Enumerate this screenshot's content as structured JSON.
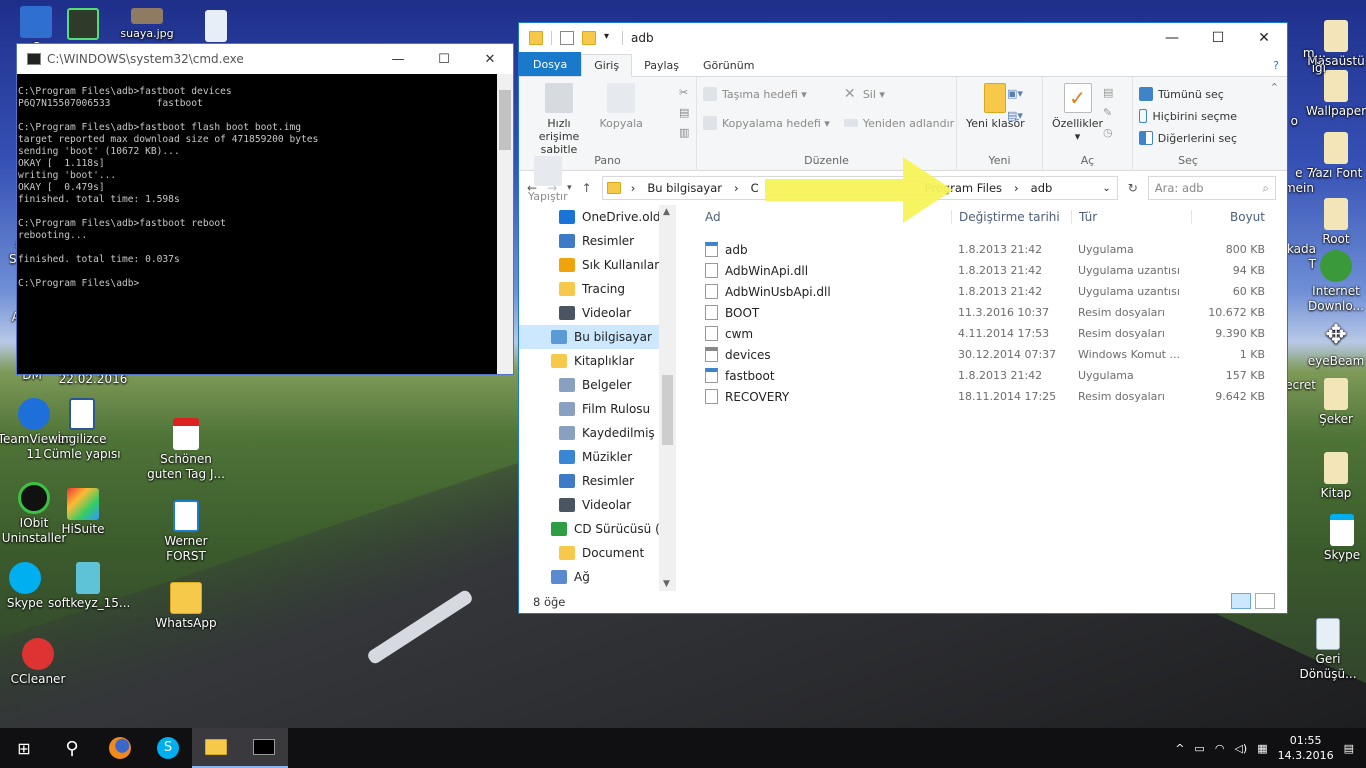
{
  "desktop": {
    "icons_left": [
      {
        "label": "",
        "glyph": "🖥"
      },
      {
        "label": "",
        "glyph": "🎞"
      },
      {
        "label": "suaya.jpg",
        "glyph": "🖼"
      },
      {
        "label": "",
        "glyph": "📄"
      },
      {
        "label": "TeamViewer 11",
        "glyph": "↔"
      },
      {
        "label": "İngilizce Cümle yapısı",
        "glyph": "W"
      },
      {
        "label": "Schönen guten Tag J...",
        "glyph": "PDF"
      },
      {
        "label": "IObit Uninstaller",
        "glyph": "U"
      },
      {
        "label": "HiSuite",
        "glyph": "◆"
      },
      {
        "label": "Werner FORST",
        "glyph": "◎"
      },
      {
        "label": "Skype",
        "glyph": "S"
      },
      {
        "label": "softkeyz_15...",
        "glyph": "▮"
      },
      {
        "label": "WhatsApp",
        "glyph": "📁"
      },
      {
        "label": "CCleaner",
        "glyph": "C"
      }
    ],
    "partial_labels": [
      "C",
      "Ac",
      "Sys",
      "A",
      "DM",
      "22.02.2016"
    ],
    "icons_right": [
      {
        "label": "Masaüstü"
      },
      {
        "label": "Wallpaper"
      },
      {
        "label": "Yazı Font"
      },
      {
        "label": "Root"
      },
      {
        "label": "Internet Downlo..."
      },
      {
        "label": "eyeBeam"
      },
      {
        "label": "Şeker"
      },
      {
        "label": "Kitap"
      },
      {
        "label": "Skype"
      },
      {
        "label": "Geri Dönüşü..."
      }
    ],
    "partial_right": [
      "m...",
      "ığı",
      "o",
      "e 7",
      "mein",
      "kada",
      "T",
      "ecret"
    ]
  },
  "cmd": {
    "title": "C:\\WINDOWS\\system32\\cmd.exe",
    "output": "C:\\Program Files\\adb>fastboot devices\nP6Q7N15507006533        fastboot\n\nC:\\Program Files\\adb>fastboot flash boot boot.img\ntarget reported max download size of 471859200 bytes\nsending 'boot' (10672 KB)...\nOKAY [  1.118s]\nwriting 'boot'...\nOKAY [  0.479s]\nfinished. total time: 1.598s\n\nC:\\Program Files\\adb>fastboot reboot\nrebooting...\n\nfinished. total time: 0.037s\n\nC:\\Program Files\\adb>"
  },
  "explorer": {
    "title": "adb",
    "tabs": {
      "file": "Dosya",
      "home": "Giriş",
      "share": "Paylaş",
      "view": "Görünüm"
    },
    "ribbon": {
      "pin": "Hızlı erişime sabitle",
      "copy": "Kopyala",
      "paste": "Yapıştır",
      "clipboard": "Pano",
      "moveto": "Taşıma hedefi",
      "copyto": "Kopyalama hedefi",
      "delete": "Sil",
      "rename": "Yeniden adlandır",
      "organize": "Düzenle",
      "newfolder": "Yeni klasör",
      "new": "Yeni",
      "properties": "Özellikler",
      "open": "Aç",
      "selectall": "Tümünü seç",
      "selectnone": "Hiçbirini seçme",
      "invert": "Diğerlerini seç",
      "select": "Seç"
    },
    "address": {
      "seg1": "Bu bilgisayar",
      "seg2": "C",
      "seg3": "Program Files",
      "seg4": "adb",
      "search": "Ara: adb"
    },
    "nav": [
      {
        "label": "OneDrive.old",
        "indent": 1
      },
      {
        "label": "Resimler",
        "indent": 1
      },
      {
        "label": "Sık Kullanılanlar",
        "indent": 1
      },
      {
        "label": "Tracing",
        "indent": 1
      },
      {
        "label": "Videolar",
        "indent": 1
      },
      {
        "label": "Bu bilgisayar",
        "indent": 0,
        "selected": true
      },
      {
        "label": "Kitaplıklar",
        "indent": 0
      },
      {
        "label": "Belgeler",
        "indent": 1
      },
      {
        "label": "Film Rulosu",
        "indent": 1
      },
      {
        "label": "Kaydedilmiş Re",
        "indent": 1
      },
      {
        "label": "Müzikler",
        "indent": 1
      },
      {
        "label": "Resimler",
        "indent": 1
      },
      {
        "label": "Videolar",
        "indent": 1
      },
      {
        "label": "CD Sürücüsü (F:)",
        "indent": 0
      },
      {
        "label": "Document",
        "indent": 1
      },
      {
        "label": "Ağ",
        "indent": 0
      }
    ],
    "columns": {
      "name": "Ad",
      "date": "Değiştirme tarihi",
      "type": "Tür",
      "size": "Boyut"
    },
    "files": [
      {
        "name": "adb",
        "date": "1.8.2013 21:42",
        "type": "Uygulama",
        "size": "800 KB"
      },
      {
        "name": "AdbWinApi.dll",
        "date": "1.8.2013 21:42",
        "type": "Uygulama uzantısı",
        "size": "94 KB"
      },
      {
        "name": "AdbWinUsbApi.dll",
        "date": "1.8.2013 21:42",
        "type": "Uygulama uzantısı",
        "size": "60 KB"
      },
      {
        "name": "BOOT",
        "date": "11.3.2016 10:37",
        "type": "Resim dosyaları",
        "size": "10.672 KB"
      },
      {
        "name": "cwm",
        "date": "4.11.2014 17:53",
        "type": "Resim dosyaları",
        "size": "9.390 KB"
      },
      {
        "name": "devices",
        "date": "30.12.2014 07:37",
        "type": "Windows Komut ...",
        "size": "1 KB"
      },
      {
        "name": "fastboot",
        "date": "1.8.2013 21:42",
        "type": "Uygulama",
        "size": "157 KB"
      },
      {
        "name": "RECOVERY",
        "date": "18.11.2014 17:25",
        "type": "Resim dosyaları",
        "size": "9.642 KB"
      }
    ],
    "status": "8 öğe"
  },
  "taskbar": {
    "time": "01:55",
    "date": "14.3.2016"
  },
  "colors": {
    "accent": "#1979ca",
    "arrow": "#f7f35a",
    "selection": "#cce8ff"
  }
}
